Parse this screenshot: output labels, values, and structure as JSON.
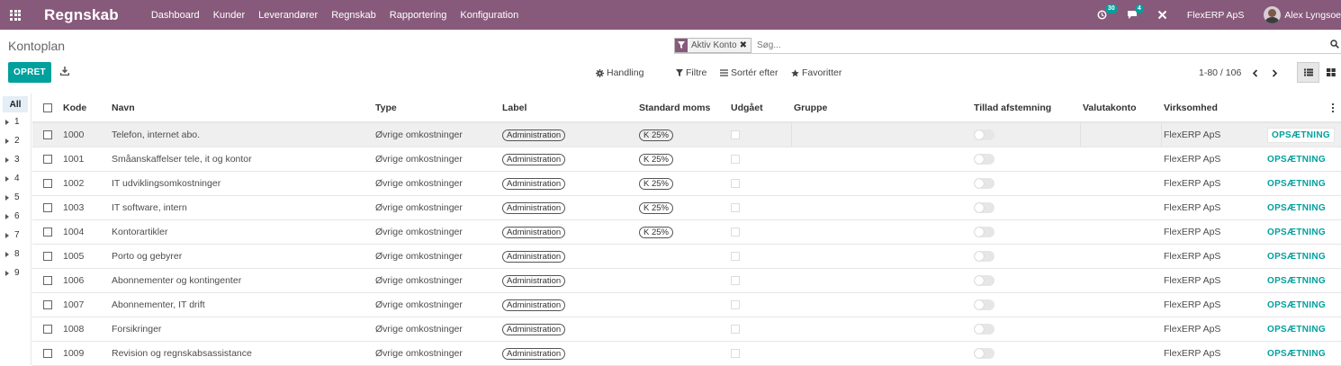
{
  "navbar": {
    "brand": "Regnskab",
    "menu": [
      "Dashboard",
      "Kunder",
      "Leverandører",
      "Regnskab",
      "Rapportering",
      "Konfiguration"
    ],
    "activity_badge": "30",
    "messages_badge": "4",
    "company": "FlexERP ApS",
    "user": "Alex Lyngsoe"
  },
  "control": {
    "breadcrumb": "Kontoplan",
    "facet": "Aktiv Konto",
    "search_placeholder": "Søg...",
    "create_label": "OPRET",
    "action_label": "Handling",
    "filter_label": "Filtre",
    "sort_label": "Sortér efter",
    "favorites_label": "Favoritter",
    "pager": "1-80 / 106"
  },
  "side_panel": {
    "all_label": "All",
    "groups": [
      "1",
      "2",
      "3",
      "4",
      "5",
      "6",
      "7",
      "8",
      "9"
    ]
  },
  "table": {
    "headers": {
      "code": "Kode",
      "name": "Navn",
      "type": "Type",
      "label": "Label",
      "tax": "Standard moms",
      "deprecated": "Udgået",
      "group": "Gruppe",
      "reconcile": "Tillad afstemning",
      "currency": "Valutakonto",
      "company": "Virksomhed"
    },
    "rows": [
      {
        "code": "1000",
        "name": "Telefon, internet abo.",
        "type": "Øvrige omkostninger",
        "label": "Administration",
        "tax": "K 25%",
        "company": "FlexERP ApS",
        "setup": "OPSÆTNING"
      },
      {
        "code": "1001",
        "name": "Småanskaffelser tele, it og kontor",
        "type": "Øvrige omkostninger",
        "label": "Administration",
        "tax": "K 25%",
        "company": "FlexERP ApS",
        "setup": "OPSÆTNING"
      },
      {
        "code": "1002",
        "name": "IT udviklingsomkostninger",
        "type": "Øvrige omkostninger",
        "label": "Administration",
        "tax": "K 25%",
        "company": "FlexERP ApS",
        "setup": "OPSÆTNING"
      },
      {
        "code": "1003",
        "name": "IT software, intern",
        "type": "Øvrige omkostninger",
        "label": "Administration",
        "tax": "K 25%",
        "company": "FlexERP ApS",
        "setup": "OPSÆTNING"
      },
      {
        "code": "1004",
        "name": "Kontorartikler",
        "type": "Øvrige omkostninger",
        "label": "Administration",
        "tax": "K 25%",
        "company": "FlexERP ApS",
        "setup": "OPSÆTNING"
      },
      {
        "code": "1005",
        "name": "Porto og gebyrer",
        "type": "Øvrige omkostninger",
        "label": "Administration",
        "tax": "",
        "company": "FlexERP ApS",
        "setup": "OPSÆTNING"
      },
      {
        "code": "1006",
        "name": "Abonnementer og kontingenter",
        "type": "Øvrige omkostninger",
        "label": "Administration",
        "tax": "",
        "company": "FlexERP ApS",
        "setup": "OPSÆTNING"
      },
      {
        "code": "1007",
        "name": "Abonnementer, IT drift",
        "type": "Øvrige omkostninger",
        "label": "Administration",
        "tax": "",
        "company": "FlexERP ApS",
        "setup": "OPSÆTNING"
      },
      {
        "code": "1008",
        "name": "Forsikringer",
        "type": "Øvrige omkostninger",
        "label": "Administration",
        "tax": "",
        "company": "FlexERP ApS",
        "setup": "OPSÆTNING"
      },
      {
        "code": "1009",
        "name": "Revision og regnskabsassistance",
        "type": "Øvrige omkostninger",
        "label": "Administration",
        "tax": "",
        "company": "FlexERP ApS",
        "setup": "OPSÆTNING"
      }
    ]
  },
  "colors": {
    "navbar": "#875a7b",
    "accent": "#00a09d"
  }
}
